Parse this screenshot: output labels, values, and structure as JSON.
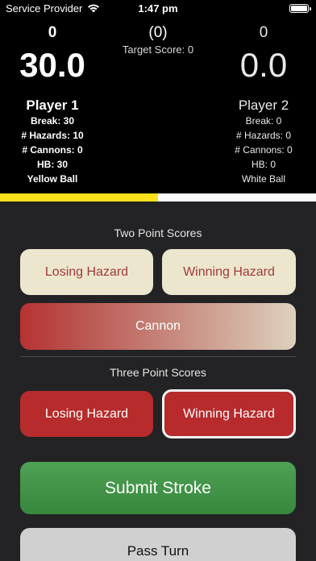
{
  "status_bar": {
    "carrier": "Service Provider",
    "time": "1:47 pm"
  },
  "scoreboard": {
    "player1": {
      "frames": "0",
      "score": "30.0",
      "name": "Player 1",
      "stats": [
        "Break: 30",
        "# Hazards: 10",
        "# Cannons: 0",
        "HB: 30",
        "Yellow Ball"
      ]
    },
    "middle": {
      "frames": "(0)",
      "target": "Target Score: 0"
    },
    "player2": {
      "frames": "0",
      "score": "0.0",
      "name": "Player 2",
      "stats": [
        "Break: 0",
        "# Hazards: 0",
        "# Cannons: 0",
        "HB: 0",
        "White Ball"
      ]
    },
    "progress": {
      "yellow_fraction": 0.5
    }
  },
  "two_point": {
    "title": "Two Point Scores",
    "losing_hazard": "Losing Hazard",
    "winning_hazard": "Winning Hazard",
    "cannon": "Cannon"
  },
  "three_point": {
    "title": "Three Point Scores",
    "losing_hazard": "Losing Hazard",
    "winning_hazard": "Winning Hazard"
  },
  "actions": {
    "submit": "Submit Stroke",
    "pass": "Pass Turn"
  },
  "colors": {
    "yellow_ball": "#f9e21c",
    "white_ball": "#fafafa",
    "hazard_red": "#b72b2c",
    "cream": "#ece6cf",
    "submit_green": "#43964a"
  }
}
